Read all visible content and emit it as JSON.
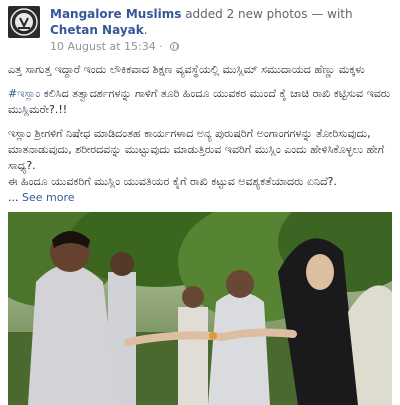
{
  "post": {
    "page_name": "Mangalore Muslims",
    "action": " added 2 new photos",
    "with_text": " — with ",
    "tagged_person": "Chetan Nayak",
    "tagged_tail": ".",
    "date": "10 August at 15:34",
    "dot": " · ",
    "avatar_text": "MANGALORE MUSLIMS",
    "paragraph_1": "ಎತ್ತ ಸಾಗುತ್ತ ಇದ್ದಾರೆ ಇಂದು ಲೌಕಿಕವಾದ ಶಿಕ್ಷಣ ವ್ಯವಸ್ಥೆಯಲ್ಲಿ ಮುಸ್ಲಿಮ್ ಸಮುದಾಯದ ಹೆಣ್ಣು ಮಕ್ಕಳು",
    "hashtag": "#ಇಸ್ಲಾಂ",
    "paragraph_2_rest": " ಕಲಿಸಿದ ತತ್ವಾದರ್ಶಗಳನ್ನು ಗಾಳಿಗೆ ತೂರಿ ಹಿಂದೂ ಯುವಕರ ಮುಂದೆ ಕೈ ಚಾಚಿ ರಾಖಿ ಕಟ್ಟಿಸುವ ಇವರು ಮುಸ್ಲಿಮರೇ?.!!",
    "paragraph_3": "ಇಸ್ಲಾಂ ಶ್ರೀಗಳಿಗೆ ನಿಷೇಧ ಮಾಡಿದಂತಹ ಕಾರ್ಯಗಳಾದ ಅನ್ಯ ಪುರುಷರಿಗೆ ಅಂಗಾಂಗಗಳನ್ನು ತೋರಿಸುವುದು, ಮಾತನಾಡುವುದು, ಶರೀರದವನ್ನು ಮುಟ್ಟುವುದು ಮಾಡುತ್ತಿರುವ ಇವರಿಗೆ ಮುಸ್ಲಿಂ ಎಂದು ಹೇಳಿಸಿಕೊಳ್ಳಲು ಹೇಗೆ ಸಾಧ್ಯ?.",
    "paragraph_4": "ಈ ಹಿಂದೂ ಯುವಕರಿಗೆ ಮುಸ್ಲಿಂ ಯುವತಿಯರ ಕೈಗೆ ರಾಖಿ ಕಟ್ಟುವ ಅವಶ್ಯಕತೆಯಾದರು ಏನಿದೆ?.",
    "ellipsis": "... ",
    "see_more": "See more"
  },
  "colors": {
    "link_blue": "#365899",
    "meta_grey": "#90949c",
    "text": "#1d2129"
  },
  "icons": {
    "privacy": "globe-icon"
  }
}
